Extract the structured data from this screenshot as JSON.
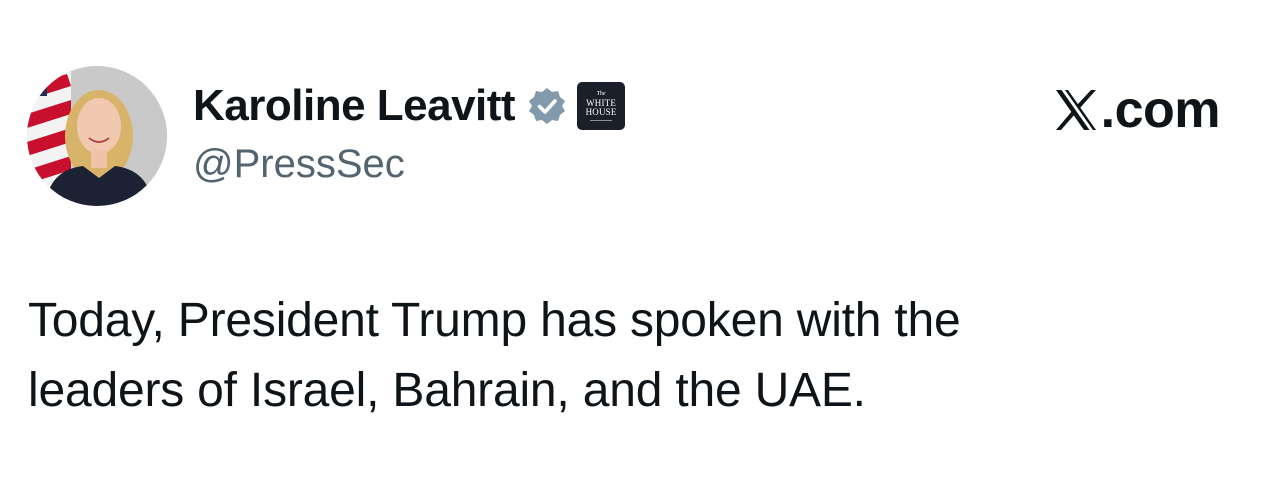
{
  "tweet": {
    "author": {
      "display_name": "Karoline Leavitt",
      "handle": "@PressSec",
      "verified_badge_icon": "verified-badge-icon",
      "verified_badge_color": "#829aab",
      "affiliation_badge": {
        "icon": "white-house-badge-icon",
        "line_1": "The",
        "line_2": "WHITE",
        "line_3": "HOUSE"
      }
    },
    "text_lines": [
      "Today, President Trump has spoken with the",
      "leaders of Israel, Bahrain, and the UAE."
    ]
  },
  "site": {
    "logo_icon": "x-logo-icon",
    "domain": ".com"
  }
}
